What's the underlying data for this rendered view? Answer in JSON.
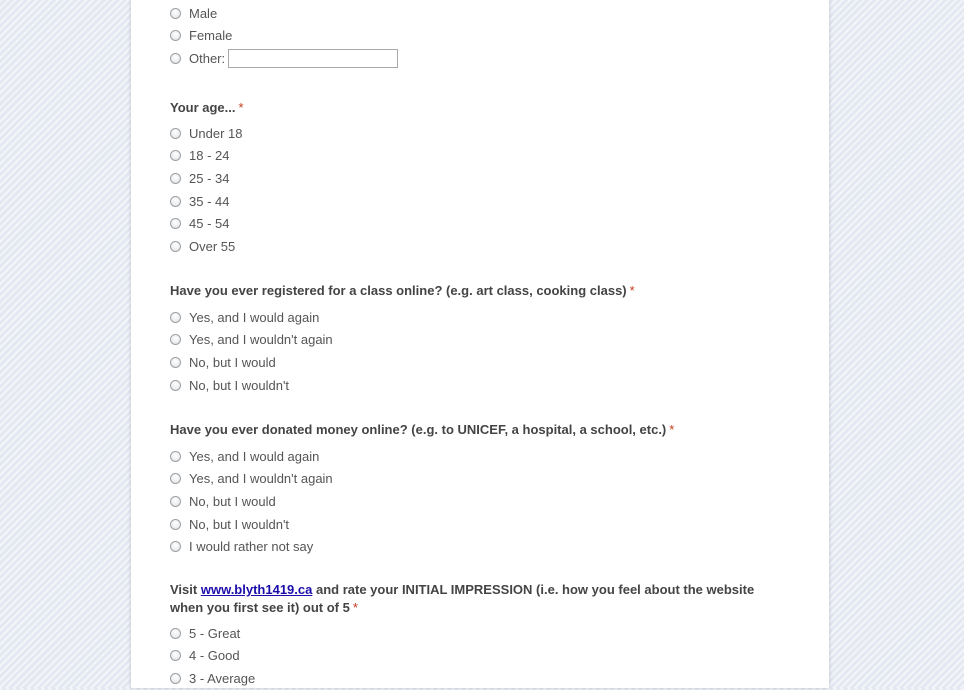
{
  "gender_question": {
    "options": [
      "Male",
      "Female",
      "Other:"
    ],
    "other_input_value": ""
  },
  "age_question": {
    "title": "Your age...",
    "required_mark": "*",
    "options": [
      "Under 18",
      "18 - 24",
      "25 - 34",
      "35 - 44",
      "45 - 54",
      "Over 55"
    ]
  },
  "class_question": {
    "title": "Have you ever registered for a class online? (e.g. art class, cooking class)",
    "required_mark": "*",
    "options": [
      "Yes, and I would again",
      "Yes, and I wouldn't again",
      "No, but I would",
      "No, but I wouldn't"
    ]
  },
  "donate_question": {
    "title": "Have you ever donated money online? (e.g. to UNICEF, a hospital, a school, etc.)",
    "required_mark": "*",
    "options": [
      "Yes, and I would again",
      "Yes, and I wouldn't again",
      "No, but I would",
      "No, but I wouldn't",
      "I would rather not say"
    ]
  },
  "impression_question": {
    "title_prefix": "Visit ",
    "link_text": "www.blyth1419.ca",
    "title_suffix": " and rate your INITIAL IMPRESSION (i.e. how you feel about the website when you first see it) out of 5",
    "required_mark": "*",
    "options": [
      "5 - Great",
      "4 - Good",
      "3 - Average"
    ]
  }
}
